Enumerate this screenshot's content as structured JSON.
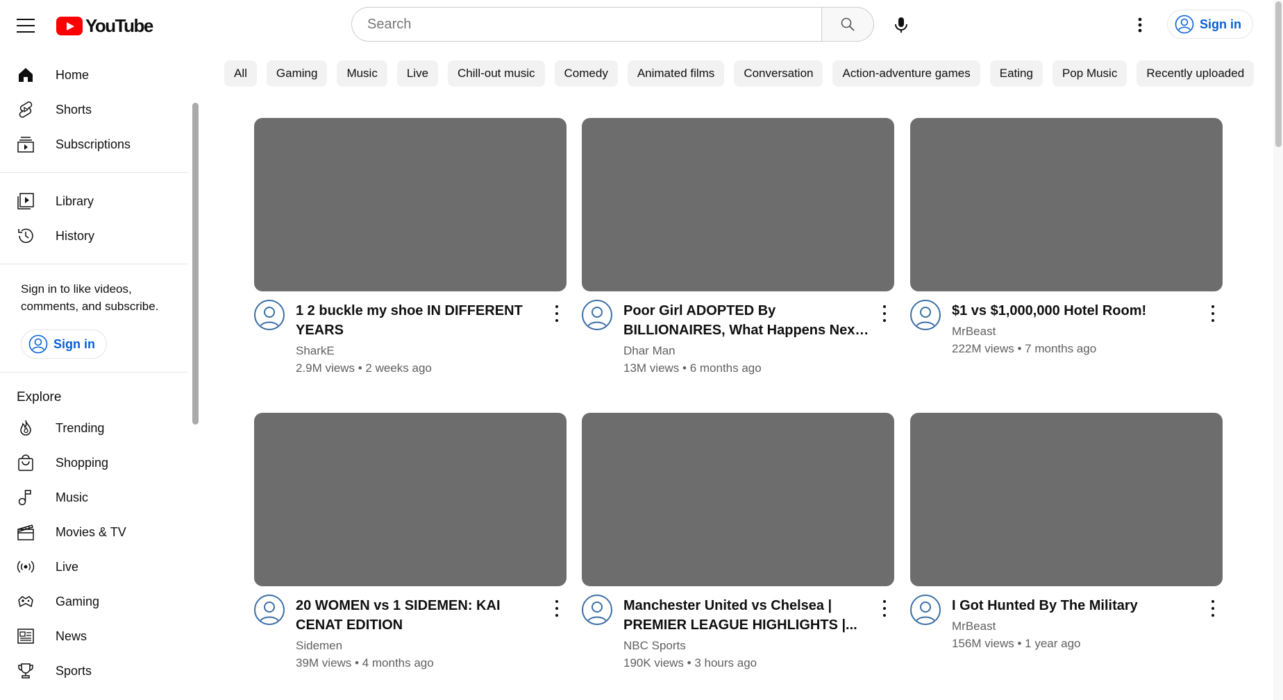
{
  "header": {
    "logo_text": "YouTube",
    "search_placeholder": "Search",
    "signin_label": "Sign in"
  },
  "sidebar": {
    "primary": [
      {
        "label": "Home",
        "icon": "home-icon"
      },
      {
        "label": "Shorts",
        "icon": "shorts-icon"
      },
      {
        "label": "Subscriptions",
        "icon": "subscriptions-icon"
      }
    ],
    "secondary": [
      {
        "label": "Library",
        "icon": "library-icon"
      },
      {
        "label": "History",
        "icon": "history-icon"
      }
    ],
    "signin_prompt": "Sign in to like videos, comments, and subscribe.",
    "signin_label": "Sign in",
    "explore_title": "Explore",
    "explore": [
      {
        "label": "Trending",
        "icon": "trending-icon"
      },
      {
        "label": "Shopping",
        "icon": "shopping-icon"
      },
      {
        "label": "Music",
        "icon": "music-icon"
      },
      {
        "label": "Movies & TV",
        "icon": "movies-icon"
      },
      {
        "label": "Live",
        "icon": "live-icon"
      },
      {
        "label": "Gaming",
        "icon": "gaming-icon"
      },
      {
        "label": "News",
        "icon": "news-icon"
      },
      {
        "label": "Sports",
        "icon": "sports-icon"
      }
    ]
  },
  "chips": [
    "All",
    "Gaming",
    "Music",
    "Live",
    "Chill-out music",
    "Comedy",
    "Animated films",
    "Conversation",
    "Action-adventure games",
    "Eating",
    "Pop Music",
    "Recently uploaded"
  ],
  "videos": [
    {
      "title": "1 2 buckle my shoe IN DIFFERENT YEARS",
      "channel": "SharkE",
      "meta": "2.9M views • 2 weeks ago"
    },
    {
      "title": "Poor Girl ADOPTED By BILLIONAIRES, What Happens Next Is Shocking | Dhar...",
      "channel": "Dhar Man",
      "meta": "13M views • 6 months ago"
    },
    {
      "title": "$1 vs $1,000,000 Hotel Room!",
      "channel": "MrBeast",
      "meta": "222M views • 7 months ago"
    },
    {
      "title": "20 WOMEN vs 1 SIDEMEN: KAI CENAT EDITION",
      "channel": "Sidemen",
      "meta": "39M views • 4 months ago"
    },
    {
      "title": "Manchester United vs Chelsea | PREMIER LEAGUE HIGHLIGHTS |...",
      "channel": "NBC Sports",
      "meta": "190K views • 3 hours ago"
    },
    {
      "title": "I Got Hunted By The Military",
      "channel": "MrBeast",
      "meta": "156M views • 1 year ago"
    }
  ],
  "colors": {
    "brand": "#ff0000",
    "link": "#065fd4",
    "thumbnail": "#6d6d6d"
  }
}
